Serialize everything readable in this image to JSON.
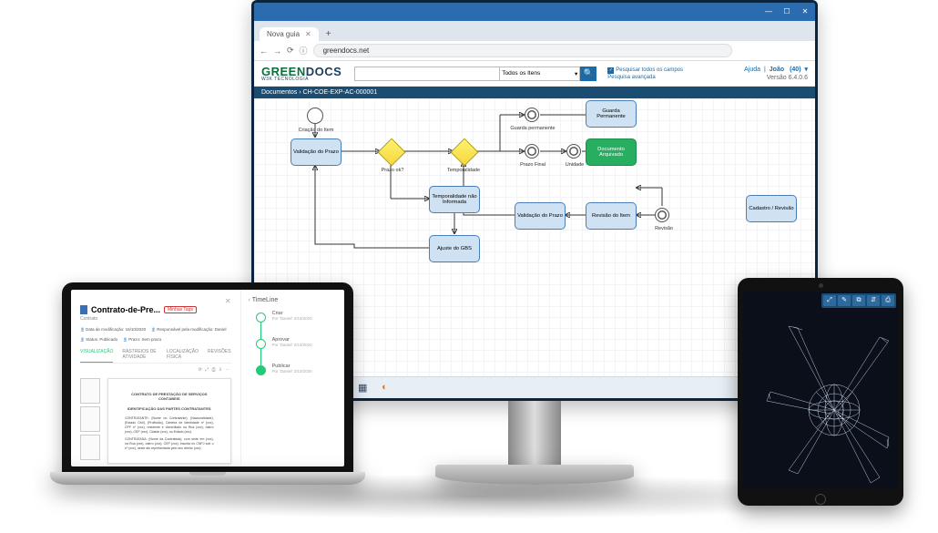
{
  "browser": {
    "tab_title": "Nova guia",
    "url": "greendocs.net",
    "window_buttons": {
      "min": "—",
      "max": "☐",
      "close": "✕"
    }
  },
  "app": {
    "logo_a": "GREEN",
    "logo_b": "DOCS",
    "logo_sub": "W3K TECNOLOGIA",
    "search_placeholder": "",
    "search_filter": "Todos os Itens",
    "search_all_fields": "Pesquisar todos os campos",
    "search_advanced": "Pesquisa avançada",
    "help": "Ajuda",
    "user_name": "João",
    "user_count": "(40)",
    "version": "Versão 6.4.0.6",
    "breadcrumb": "Documentos › CH-COE-EXP-AC-000001"
  },
  "workflow": {
    "criacao": "Criação do Item",
    "validacao": "Validação do Prazo",
    "prazo_ok": "Prazo ok?",
    "temporalidade_gw": "Temporalidade",
    "temporalidade_nao": "Temporalidade não Informada",
    "ajuste_gbs": "Ajuste do GBS",
    "guarda_perm_ev": "Guarda permanente",
    "prazo_final": "Prazo Final",
    "unidade": "Unidade",
    "guarda_perm": "Guarda Permanente",
    "documento_arq": "Documento Arquivado",
    "validacao2": "Validação do Prazo",
    "revisao_item": "Revisão do Item",
    "revisao": "Revisão",
    "cadastro": "Cadastro / Revisão"
  },
  "laptop": {
    "title": "Contrato-de-Pre...",
    "badge": "Minhas Tags",
    "sub": "Contrato",
    "meta1": "Data de modificação: 16/10/2020",
    "meta2": "Responsável pela modificação: Daniel",
    "meta3": "Status: Publicado",
    "meta4": "Prazo: Sem prazo",
    "tabs": [
      "VISUALIZAÇÃO",
      "RASTREIOS DE ATIVIDADE",
      "LOCALIZAÇÃO FÍSICA",
      "REVISÕES"
    ],
    "doc_h1": "CONTRATO DE PRESTAÇÃO DE SERVIÇOS CONTÁBEIS",
    "doc_h2": "IDENTIFICAÇÃO DAS PARTES CONTRATANTES",
    "timeline_title": "TimeLine",
    "timeline": [
      {
        "a": "Criar",
        "b": "Por 'Daniel' 2/10/2020"
      },
      {
        "a": "Aprovar",
        "b": "Por 'Daniel' 2/10/2020"
      },
      {
        "a": "Publicar",
        "b": "Por 'Daniel' 2/10/2020"
      }
    ]
  },
  "tablet": {
    "toolbar_icons": [
      "⤢",
      "✎",
      "⧉",
      "⇵",
      "⎙"
    ]
  },
  "taskbar_icons": [
    "●",
    "✿",
    "⚙",
    "≡",
    "▦",
    "◐"
  ]
}
